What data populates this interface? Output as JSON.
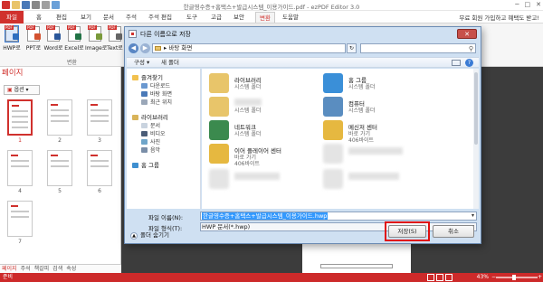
{
  "app": {
    "title": "한글영수증+홈택스+발급시스템_이용가이드.pdf - ezPDF Editor 3.0",
    "min_label": "─",
    "max_label": "□",
    "close_label": "✕"
  },
  "ribbon": {
    "file_tab": "파일",
    "tabs": [
      "홈",
      "편집",
      "보기",
      "문서",
      "주석",
      "주석 편집",
      "도구",
      "고급",
      "보안",
      "변환",
      "도움말"
    ],
    "right_text": "무료 회원 가입하고 혜택도 받고!",
    "buttons": [
      {
        "label": "HWP로",
        "tag": "PDF",
        "overlay_color": "#2f6fbf"
      },
      {
        "label": "PPT로",
        "tag": "PDF",
        "overlay_color": "#d35230"
      },
      {
        "label": "Word로",
        "tag": "PDF",
        "overlay_color": "#2b579a"
      },
      {
        "label": "Excel로",
        "tag": "PDF",
        "overlay_color": "#217346"
      },
      {
        "label": "Image로",
        "tag": "PDF",
        "overlay_color": "#7a9a3a"
      },
      {
        "label": "Text로",
        "tag": "PDF",
        "overlay_color": "#666666"
      }
    ],
    "group_label": "변환"
  },
  "pages_panel": {
    "title": "페이지",
    "options_label": "옵션",
    "thumbnails": [
      "1",
      "2",
      "3",
      "4",
      "5",
      "6",
      "7"
    ],
    "selected_page": "1",
    "tabs": [
      "페이지",
      "주석",
      "책갈피",
      "검색",
      "속성"
    ]
  },
  "statusbar": {
    "left_text": "준비",
    "zoom": "43%",
    "zoom_minus": "−",
    "zoom_plus": "+"
  },
  "dialog": {
    "title": "다른 이름으로 저장",
    "close_label": "✕",
    "back_label": "◀",
    "forward_label": "▶",
    "address": "바탕 화면",
    "address_arrow": "▸",
    "refresh_label": "↻",
    "search_icon_glyph": "⚲",
    "toolbar": {
      "organize": "구성 ▾",
      "new_folder": "새 폴더",
      "help": "?"
    },
    "nav": {
      "favorites": "즐겨찾기",
      "favorites_items": [
        "다운로드",
        "바탕 화면",
        "최근 위치"
      ],
      "libraries": "라이브러리",
      "library_items": [
        "문서",
        "비디오",
        "사진",
        "음악"
      ],
      "homegroup": "홈 그룹"
    },
    "files": [
      {
        "name": "라이브러리",
        "type": "시스템 폴더",
        "size": ""
      },
      {
        "name": "홈 그룹",
        "type": "시스템 폴더",
        "size": ""
      },
      {
        "name": "",
        "type": "시스템 폴더",
        "size": ""
      },
      {
        "name": "컴퓨터",
        "type": "시스템 폴더",
        "size": ""
      },
      {
        "name": "네트워크",
        "type": "시스템 폴더",
        "size": ""
      },
      {
        "name": "메신저 센터",
        "type": "바로 가기",
        "size": "406바이트"
      },
      {
        "name": "이어 플레이어 센터",
        "type": "바로 가기",
        "size": "406바이트"
      }
    ],
    "filename_label": "파일 이름(N):",
    "filename_value": "한글영수증+홈택스+발급시스템_이용가이드.hwp",
    "filetype_label": "파일 형식(T):",
    "filetype_value": "HWP 문서(*.hwp)",
    "hide_folders": "폴더 숨기기",
    "save_label": "저장(S)",
    "cancel_label": "취소"
  },
  "colors": {
    "accent": "#d0312d",
    "dialog_bg": "#cfe0f2",
    "doc_bg": "#3c3c3c",
    "highlight": "#e01010"
  }
}
